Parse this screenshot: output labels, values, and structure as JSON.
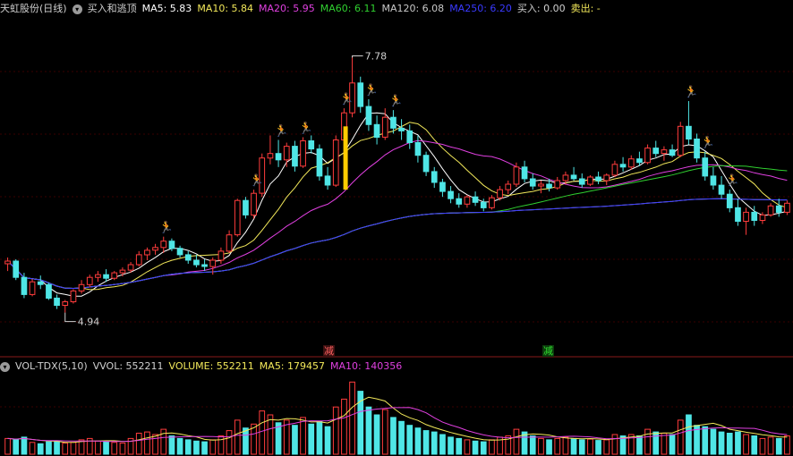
{
  "header": {
    "stock_name": "天虹股份(日线)",
    "indicator_name": "买入和逃顶",
    "ma5": "MA5: 5.83",
    "ma10": "MA10: 5.84",
    "ma20": "MA20: 5.95",
    "ma60": "MA60: 6.11",
    "ma120": "MA120: 6.08",
    "ma250": "MA250: 6.20",
    "buy": "买入: 0.00",
    "sell": "卖出: -"
  },
  "vol_header": {
    "indicator": "VOL-TDX(5,10)",
    "vvol": "VVOL: 552211",
    "volume": "VOLUME: 552211",
    "ma5": "MA5: 179457",
    "ma10": "MA10: 140356"
  },
  "annotations": {
    "high_label": "7.78",
    "low_label": "4.94",
    "marker_1": "减",
    "marker_2": "减"
  },
  "colors": {
    "up": "#ff3c3c",
    "down": "#4fe6e6",
    "ma5": "#ffffff",
    "ma10": "#f2e85a",
    "ma20": "#e040e0",
    "ma60": "#30d030",
    "ma120": "#c8c8c8",
    "ma250": "#3a3aff",
    "signal": "#ffcc00",
    "figure": "#f0a030",
    "text": "#d0d0d0"
  },
  "chart_data": {
    "type": "candlestick",
    "price_ylim": [
      4.6,
      8.2
    ],
    "volume_ylim": [
      0,
      600000
    ],
    "candles": [
      [
        5.48,
        5.55,
        5.4,
        5.51,
        120000
      ],
      [
        5.51,
        5.53,
        5.3,
        5.33,
        110000
      ],
      [
        5.33,
        5.38,
        5.1,
        5.14,
        130000
      ],
      [
        5.14,
        5.31,
        5.12,
        5.28,
        90000
      ],
      [
        5.28,
        5.35,
        5.2,
        5.25,
        80000
      ],
      [
        5.25,
        5.27,
        5.08,
        5.1,
        95000
      ],
      [
        5.1,
        5.14,
        4.98,
        5.02,
        100000
      ],
      [
        5.02,
        5.08,
        4.94,
        5.06,
        85000
      ],
      [
        5.06,
        5.2,
        5.04,
        5.18,
        90000
      ],
      [
        5.18,
        5.3,
        5.15,
        5.25,
        110000
      ],
      [
        5.25,
        5.36,
        5.22,
        5.33,
        120000
      ],
      [
        5.33,
        5.4,
        5.28,
        5.36,
        100000
      ],
      [
        5.36,
        5.42,
        5.28,
        5.32,
        95000
      ],
      [
        5.32,
        5.4,
        5.3,
        5.38,
        90000
      ],
      [
        5.38,
        5.44,
        5.34,
        5.41,
        85000
      ],
      [
        5.41,
        5.5,
        5.38,
        5.47,
        120000
      ],
      [
        5.47,
        5.62,
        5.45,
        5.58,
        160000
      ],
      [
        5.58,
        5.66,
        5.52,
        5.63,
        170000
      ],
      [
        5.63,
        5.7,
        5.58,
        5.66,
        150000
      ],
      [
        5.66,
        5.78,
        5.6,
        5.73,
        190000
      ],
      [
        5.73,
        5.76,
        5.62,
        5.65,
        140000
      ],
      [
        5.65,
        5.68,
        5.55,
        5.58,
        120000
      ],
      [
        5.58,
        5.62,
        5.48,
        5.52,
        110000
      ],
      [
        5.52,
        5.58,
        5.44,
        5.47,
        100000
      ],
      [
        5.47,
        5.53,
        5.4,
        5.45,
        95000
      ],
      [
        5.45,
        5.55,
        5.36,
        5.52,
        110000
      ],
      [
        5.52,
        5.66,
        5.48,
        5.62,
        140000
      ],
      [
        5.62,
        5.85,
        5.6,
        5.8,
        180000
      ],
      [
        5.8,
        6.2,
        5.78,
        6.18,
        260000
      ],
      [
        6.18,
        6.22,
        5.98,
        6.02,
        200000
      ],
      [
        6.02,
        6.3,
        5.98,
        6.26,
        230000
      ],
      [
        6.26,
        6.7,
        6.22,
        6.65,
        330000
      ],
      [
        6.65,
        6.9,
        6.58,
        6.7,
        300000
      ],
      [
        6.7,
        6.85,
        6.55,
        6.63,
        240000
      ],
      [
        6.63,
        6.82,
        6.55,
        6.78,
        260000
      ],
      [
        6.78,
        6.84,
        6.5,
        6.56,
        220000
      ],
      [
        6.56,
        6.88,
        6.54,
        6.84,
        280000
      ],
      [
        6.84,
        6.9,
        6.7,
        6.75,
        230000
      ],
      [
        6.75,
        6.8,
        6.4,
        6.45,
        250000
      ],
      [
        6.45,
        6.55,
        6.3,
        6.35,
        210000
      ],
      [
        6.35,
        6.9,
        6.33,
        6.85,
        360000
      ],
      [
        6.85,
        7.2,
        6.82,
        7.15,
        420000
      ],
      [
        7.15,
        7.78,
        7.1,
        7.48,
        550000
      ],
      [
        7.48,
        7.55,
        7.15,
        7.22,
        480000
      ],
      [
        7.22,
        7.3,
        6.95,
        7.02,
        360000
      ],
      [
        7.02,
        7.12,
        6.8,
        6.88,
        300000
      ],
      [
        6.88,
        7.2,
        6.85,
        7.1,
        340000
      ],
      [
        7.1,
        7.18,
        6.92,
        6.98,
        280000
      ],
      [
        6.98,
        7.08,
        6.85,
        6.95,
        250000
      ],
      [
        6.95,
        7.02,
        6.75,
        6.82,
        220000
      ],
      [
        6.82,
        6.9,
        6.6,
        6.68,
        200000
      ],
      [
        6.68,
        6.72,
        6.45,
        6.5,
        180000
      ],
      [
        6.5,
        6.55,
        6.32,
        6.38,
        170000
      ],
      [
        6.38,
        6.42,
        6.22,
        6.28,
        150000
      ],
      [
        6.28,
        6.34,
        6.15,
        6.2,
        130000
      ],
      [
        6.2,
        6.26,
        6.1,
        6.14,
        120000
      ],
      [
        6.14,
        6.24,
        6.1,
        6.22,
        110000
      ],
      [
        6.22,
        6.28,
        6.12,
        6.16,
        100000
      ],
      [
        6.16,
        6.2,
        6.06,
        6.1,
        95000
      ],
      [
        6.1,
        6.24,
        6.08,
        6.21,
        110000
      ],
      [
        6.21,
        6.34,
        6.18,
        6.3,
        130000
      ],
      [
        6.3,
        6.4,
        6.25,
        6.36,
        140000
      ],
      [
        6.36,
        6.6,
        6.33,
        6.55,
        190000
      ],
      [
        6.55,
        6.62,
        6.38,
        6.42,
        170000
      ],
      [
        6.42,
        6.48,
        6.3,
        6.34,
        140000
      ],
      [
        6.34,
        6.4,
        6.26,
        6.36,
        120000
      ],
      [
        6.36,
        6.42,
        6.28,
        6.32,
        110000
      ],
      [
        6.32,
        6.44,
        6.3,
        6.4,
        120000
      ],
      [
        6.4,
        6.5,
        6.36,
        6.46,
        130000
      ],
      [
        6.46,
        6.55,
        6.4,
        6.42,
        120000
      ],
      [
        6.42,
        6.48,
        6.32,
        6.36,
        110000
      ],
      [
        6.36,
        6.46,
        6.34,
        6.44,
        115000
      ],
      [
        6.44,
        6.5,
        6.36,
        6.4,
        105000
      ],
      [
        6.4,
        6.48,
        6.35,
        6.46,
        110000
      ],
      [
        6.46,
        6.62,
        6.44,
        6.58,
        150000
      ],
      [
        6.58,
        6.66,
        6.5,
        6.55,
        140000
      ],
      [
        6.55,
        6.68,
        6.52,
        6.64,
        150000
      ],
      [
        6.64,
        6.72,
        6.56,
        6.6,
        140000
      ],
      [
        6.6,
        6.8,
        6.58,
        6.76,
        190000
      ],
      [
        6.76,
        6.84,
        6.66,
        6.7,
        170000
      ],
      [
        6.7,
        6.78,
        6.62,
        6.74,
        160000
      ],
      [
        6.74,
        6.8,
        6.66,
        6.68,
        150000
      ],
      [
        6.68,
        7.05,
        6.66,
        7.0,
        260000
      ],
      [
        7.0,
        7.28,
        6.8,
        6.86,
        300000
      ],
      [
        6.86,
        6.92,
        6.6,
        6.65,
        220000
      ],
      [
        6.65,
        6.72,
        6.4,
        6.45,
        210000
      ],
      [
        6.45,
        6.55,
        6.3,
        6.35,
        190000
      ],
      [
        6.35,
        6.45,
        6.2,
        6.25,
        170000
      ],
      [
        6.25,
        6.3,
        6.05,
        6.1,
        160000
      ],
      [
        6.1,
        6.2,
        5.9,
        5.95,
        170000
      ],
      [
        5.95,
        6.1,
        5.8,
        6.05,
        150000
      ],
      [
        6.05,
        6.12,
        5.9,
        5.96,
        140000
      ],
      [
        5.96,
        6.05,
        5.92,
        6.02,
        120000
      ],
      [
        6.02,
        6.15,
        6.0,
        6.12,
        130000
      ],
      [
        6.12,
        6.2,
        6.0,
        6.05,
        120000
      ],
      [
        6.05,
        6.18,
        6.02,
        6.15,
        140000
      ]
    ],
    "high_label": "7.78",
    "low_label": "4.94",
    "signal_bars": [
      42
    ],
    "buy_figures": [
      19,
      30,
      33,
      36,
      41,
      44,
      47,
      83,
      85,
      88
    ]
  }
}
